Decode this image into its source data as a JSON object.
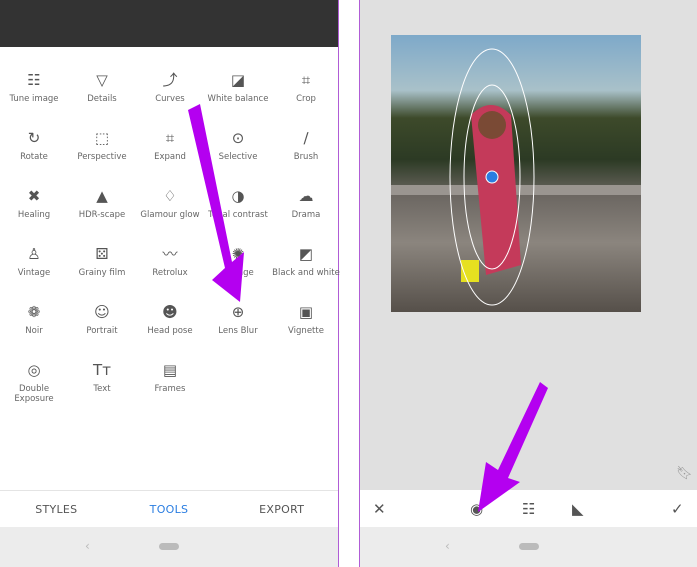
{
  "tools": [
    {
      "label": "Tune image",
      "icon": "tune-icon",
      "glyph": "☷"
    },
    {
      "label": "Details",
      "icon": "triangle-icon",
      "glyph": "▽"
    },
    {
      "label": "Curves",
      "icon": "curves-icon",
      "glyph": "⤴"
    },
    {
      "label": "White balance",
      "icon": "white-balance-icon",
      "glyph": "◪"
    },
    {
      "label": "Crop",
      "icon": "crop-icon",
      "glyph": "⌗"
    },
    {
      "label": "Rotate",
      "icon": "rotate-icon",
      "glyph": "↻"
    },
    {
      "label": "Perspective",
      "icon": "perspective-icon",
      "glyph": "⬚"
    },
    {
      "label": "Expand",
      "icon": "expand-icon",
      "glyph": "⌗"
    },
    {
      "label": "Selective",
      "icon": "selective-icon",
      "glyph": "⊙"
    },
    {
      "label": "Brush",
      "icon": "brush-icon",
      "glyph": "∕"
    },
    {
      "label": "Healing",
      "icon": "healing-icon",
      "glyph": "✖"
    },
    {
      "label": "HDR-scape",
      "icon": "mountain-icon",
      "glyph": "▲"
    },
    {
      "label": "Glamour glow",
      "icon": "diamond-icon",
      "glyph": "♢"
    },
    {
      "label": "Tonal contrast",
      "icon": "tonal-icon",
      "glyph": "◑"
    },
    {
      "label": "Drama",
      "icon": "cloud-icon",
      "glyph": "☁"
    },
    {
      "label": "Vintage",
      "icon": "lamp-icon",
      "glyph": "♙"
    },
    {
      "label": "Grainy film",
      "icon": "grain-icon",
      "glyph": "⚄"
    },
    {
      "label": "Retrolux",
      "icon": "mustache-icon",
      "glyph": "〰"
    },
    {
      "label": "Grunge",
      "icon": "grunge-icon",
      "glyph": "✺"
    },
    {
      "label": "Black and white",
      "icon": "bw-icon",
      "glyph": "◩"
    },
    {
      "label": "Noir",
      "icon": "film-reel-icon",
      "glyph": "❁"
    },
    {
      "label": "Portrait",
      "icon": "face-icon",
      "glyph": "☺"
    },
    {
      "label": "Head pose",
      "icon": "head-pose-icon",
      "glyph": "☻"
    },
    {
      "label": "Lens Blur",
      "icon": "lens-blur-icon",
      "glyph": "⊕"
    },
    {
      "label": "Vignette",
      "icon": "vignette-icon",
      "glyph": "▣"
    },
    {
      "label": "Double Exposure",
      "icon": "double-exposure-icon",
      "glyph": "◎"
    },
    {
      "label": "Text",
      "icon": "text-icon",
      "glyph": "Tт"
    },
    {
      "label": "Frames",
      "icon": "frame-icon",
      "glyph": "▤"
    }
  ],
  "tabs": {
    "styles": "STYLES",
    "tools": "TOOLS",
    "export": "EXPORT"
  },
  "colors": {
    "accent": "#2a7de1",
    "arrow": "#b400f0",
    "point": "#2a7de1"
  },
  "right_toolbar": {
    "cancel": "✕",
    "blur_shape": "◉",
    "adjust": "☷",
    "styles": "◣",
    "apply": "✓"
  },
  "nav": {
    "back": "‹"
  }
}
